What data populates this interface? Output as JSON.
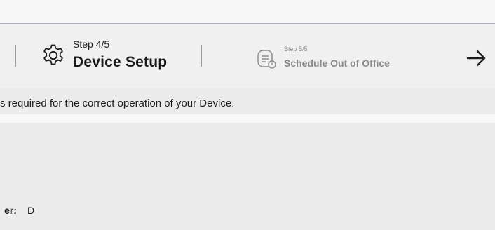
{
  "stepper": {
    "current_step": {
      "label": "Step 4/5",
      "title": "Device Setup",
      "icon": "gear-icon"
    },
    "next_step": {
      "label": "Step 5/5",
      "title": "Schedule Out of Office",
      "icon": "document-clock-icon"
    },
    "next_icon": "arrow-right-icon"
  },
  "info": {
    "text": "s required for the correct operation of your Device."
  },
  "form": {
    "field_label": "er:",
    "field_value": "D"
  },
  "colors": {
    "background": "#ececec",
    "stepper_bg": "#f0f0f0",
    "inactive_text": "#8a8a8a",
    "active_text": "#1a1a1a"
  }
}
